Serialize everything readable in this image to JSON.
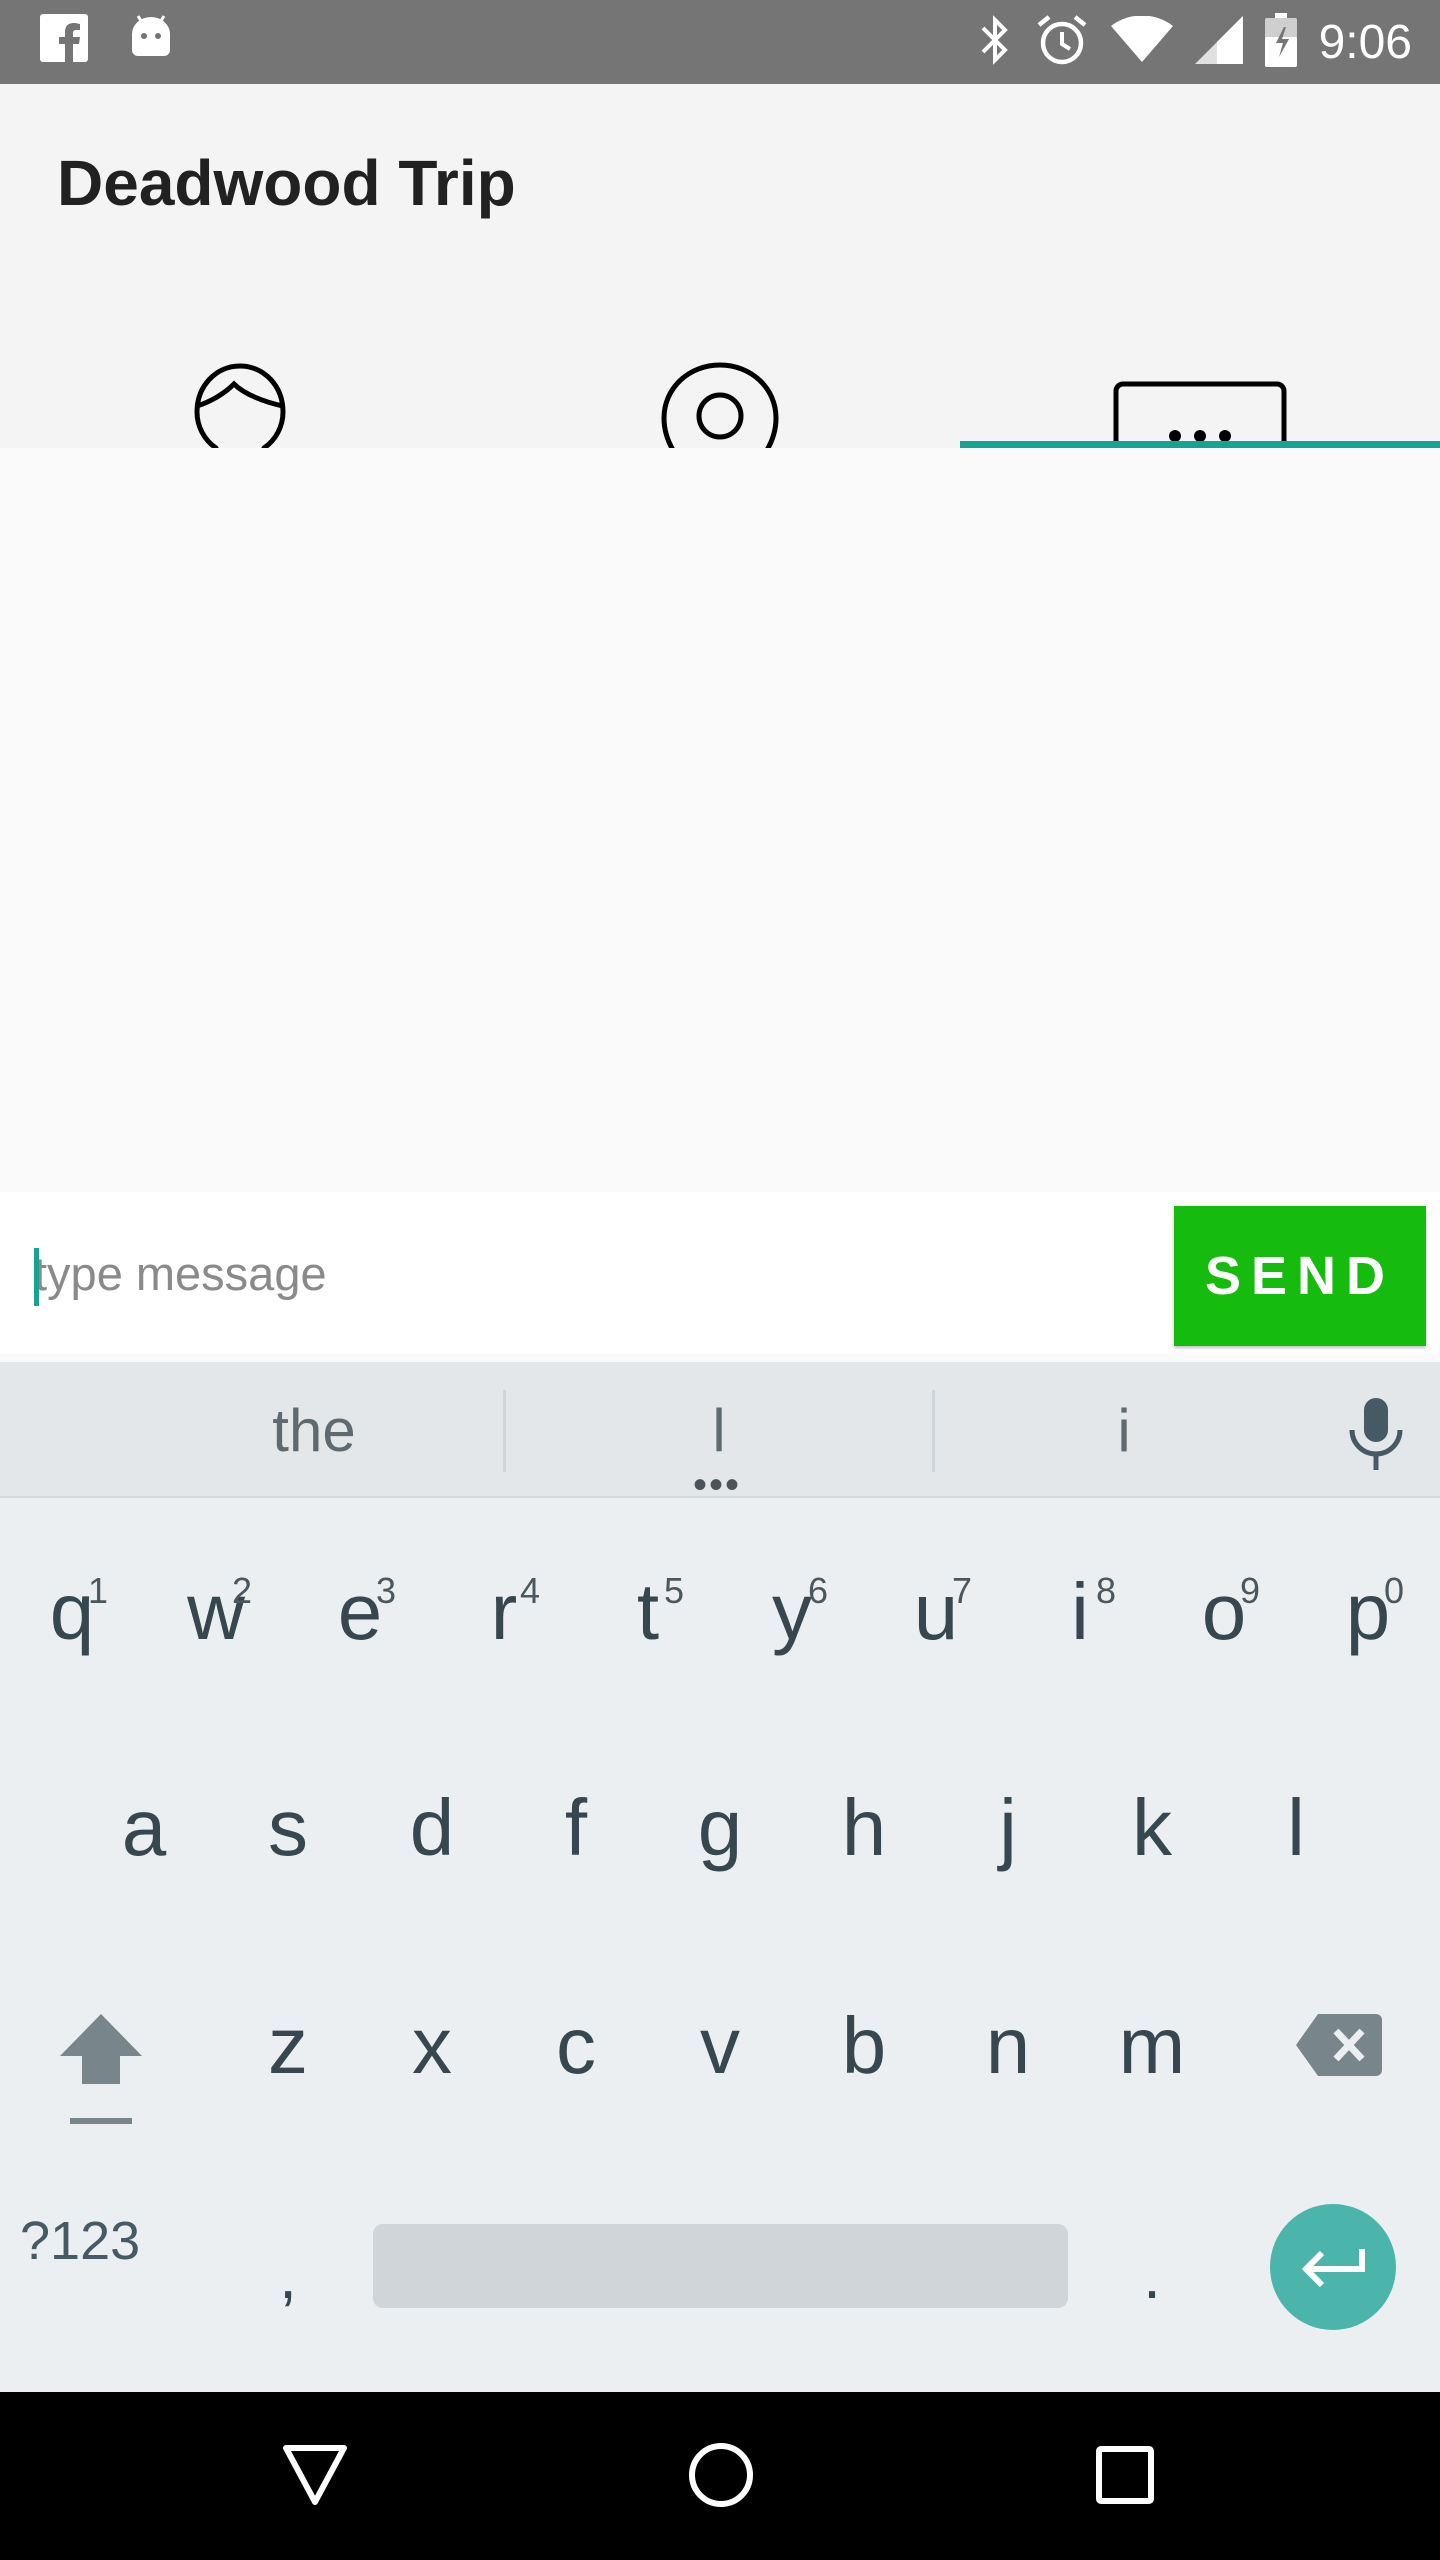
{
  "status_bar": {
    "time": "9:06",
    "left_icons": [
      "facebook-icon",
      "android-icon"
    ],
    "right_icons": [
      "bluetooth-icon",
      "alarm-icon",
      "wifi-icon",
      "signal-icon",
      "battery-icon"
    ]
  },
  "app": {
    "title": "Deadwood Trip"
  },
  "tabs": [
    {
      "icon": "person-icon",
      "selected": false
    },
    {
      "icon": "location-pin-icon",
      "selected": false
    },
    {
      "icon": "chat-bubble-icon",
      "selected": true
    }
  ],
  "accent_color": "#17a393",
  "composer": {
    "placeholder": "type message",
    "value": "",
    "send_label": "SEND",
    "send_color": "#15bb0d"
  },
  "keyboard": {
    "suggestions": [
      "the",
      "l",
      "i"
    ],
    "row1": [
      {
        "k": "q",
        "h": "1"
      },
      {
        "k": "w",
        "h": "2"
      },
      {
        "k": "e",
        "h": "3"
      },
      {
        "k": "r",
        "h": "4"
      },
      {
        "k": "t",
        "h": "5"
      },
      {
        "k": "y",
        "h": "6"
      },
      {
        "k": "u",
        "h": "7"
      },
      {
        "k": "i",
        "h": "8"
      },
      {
        "k": "o",
        "h": "9"
      },
      {
        "k": "p",
        "h": "0"
      }
    ],
    "row2": [
      "a",
      "s",
      "d",
      "f",
      "g",
      "h",
      "j",
      "k",
      "l"
    ],
    "row3": [
      "z",
      "x",
      "c",
      "v",
      "b",
      "n",
      "m"
    ],
    "symbols_label": "?123",
    "comma": ",",
    "period": "."
  },
  "nav_bar": {
    "buttons": [
      "back-icon",
      "home-icon",
      "recents-icon"
    ]
  }
}
